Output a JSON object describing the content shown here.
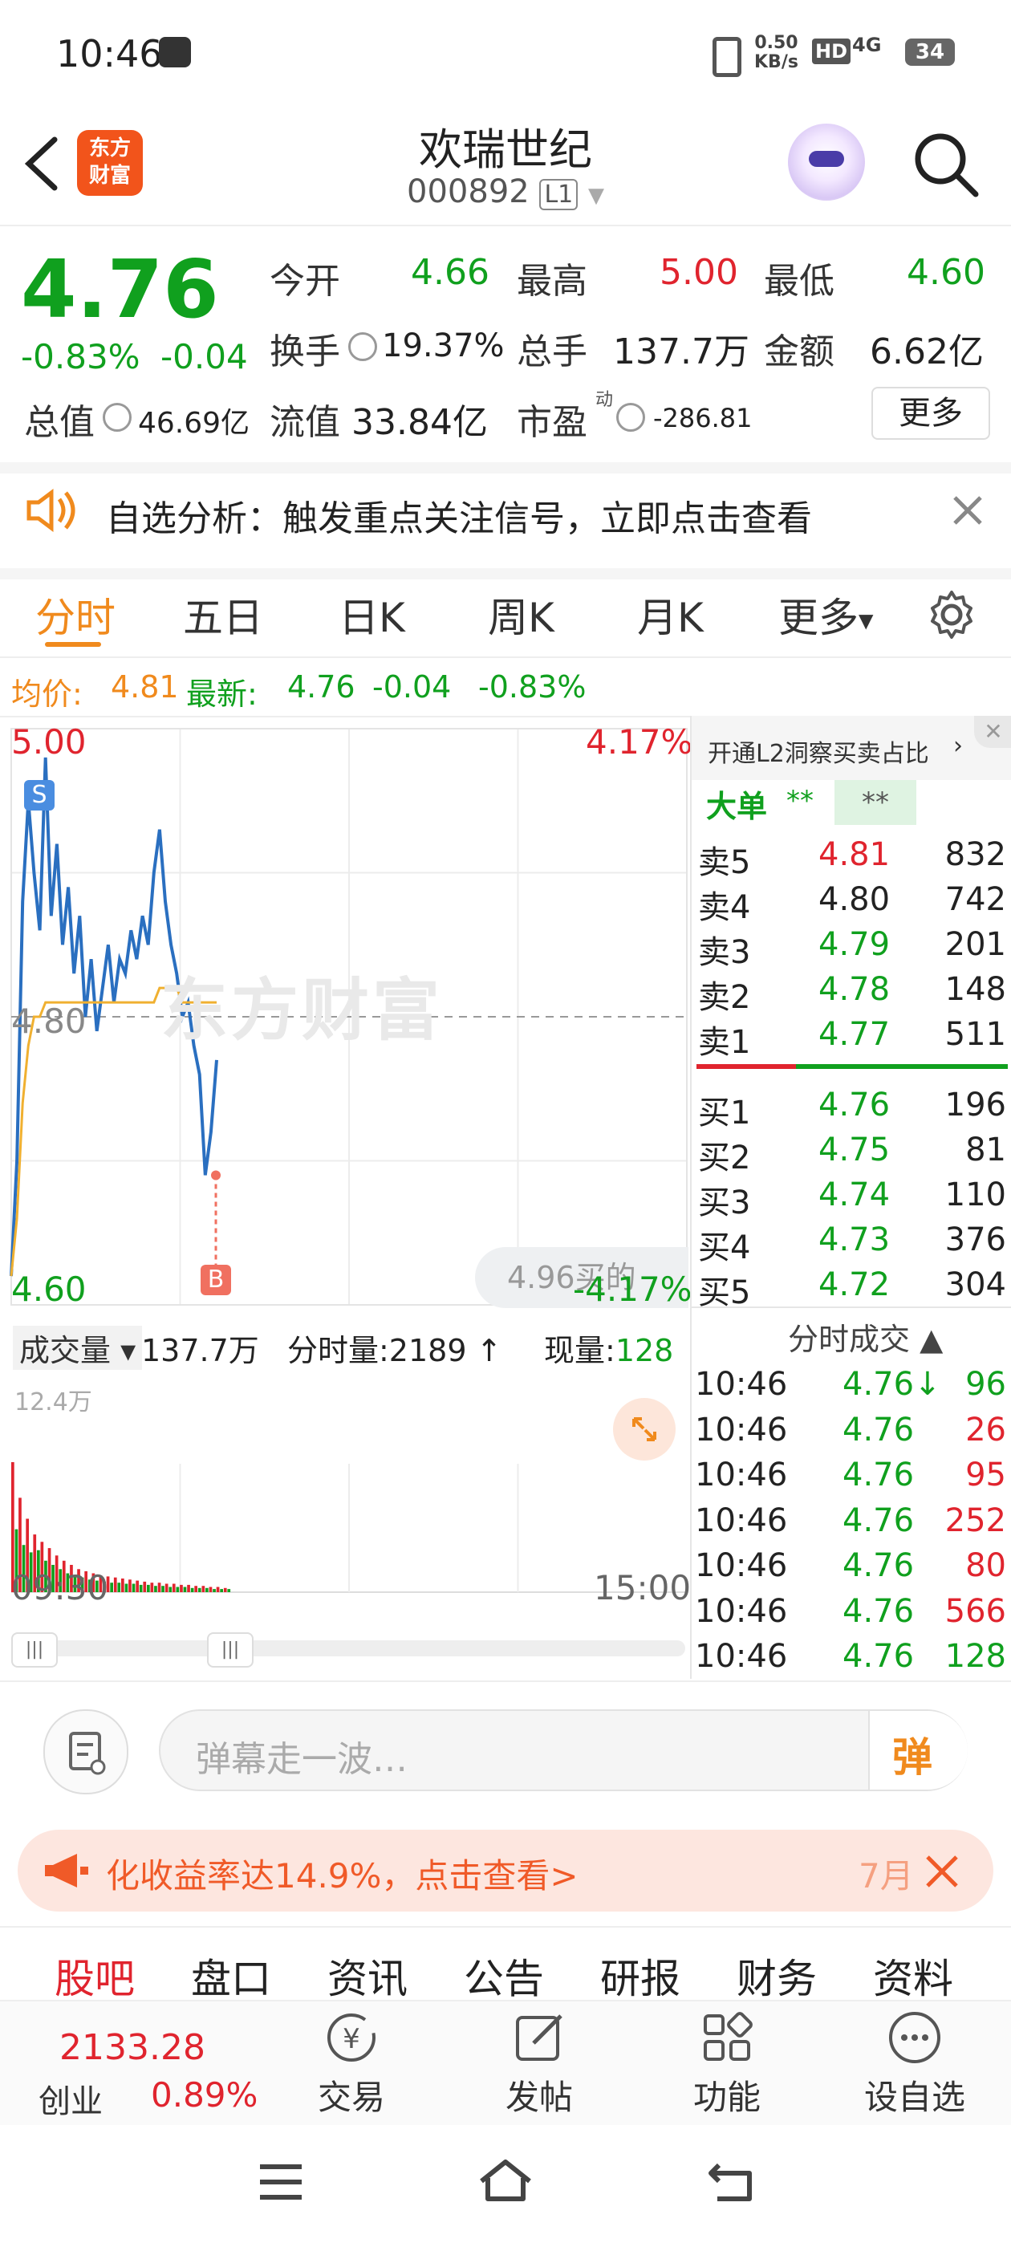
{
  "status_bar": {
    "time": "10:46",
    "net_speed_top": "0.50",
    "net_speed_bottom": "KB/s",
    "hd": "HD",
    "signal": "4G",
    "battery": "34"
  },
  "header": {
    "logo_line1": "东方",
    "logo_line2": "财富",
    "title": "欢瑞世纪",
    "code": "000892",
    "level": "L1"
  },
  "quote": {
    "price": "4.76",
    "change_pct": "-0.83%",
    "change": "-0.04",
    "open_label": "今开",
    "open": "4.66",
    "high_label": "最高",
    "high": "5.00",
    "low_label": "最低",
    "low": "4.60",
    "turnover_label": "换手",
    "turnover": "19.37%",
    "volume_label": "总手",
    "volume": "137.7万",
    "amount_label": "金额",
    "amount": "6.62亿",
    "total_value_label": "总值",
    "total_value": "46.69亿",
    "float_value_label": "流值",
    "float_value": "33.84亿",
    "pe_label": "市盈",
    "pe_sup": "动",
    "pe": "-286.81",
    "more_button": "更多"
  },
  "alert": {
    "text": "自选分析：触发重点关注信号，立即点击查看"
  },
  "tabs": [
    {
      "label": "分时",
      "active": true
    },
    {
      "label": "五日"
    },
    {
      "label": "日K"
    },
    {
      "label": "周K"
    },
    {
      "label": "月K"
    },
    {
      "label": "更多"
    }
  ],
  "price_line": {
    "avg_label": "均价:",
    "avg": "4.81",
    "latest_label": "最新:",
    "latest": "4.76",
    "change": "-0.04",
    "change_pct": "-0.83%"
  },
  "chart": {
    "y_top": "5.00",
    "y_mid": "4.80",
    "y_bottom": "4.60",
    "pct_top": "4.17%",
    "pct_bottom": "-4.17%",
    "marker_s": "S",
    "marker_b": "B",
    "watermark": "东方财富",
    "bubble": "4.96买的",
    "vol_label": "成交量",
    "vol_total": "137.7万",
    "vol_tick_label": "分时量:2189",
    "cur_vol_label": "现量:",
    "cur_vol": "128",
    "vol_max": "12.4万",
    "time_start": "09:30",
    "time_end": "15:00"
  },
  "chart_data": {
    "type": "line",
    "title": "",
    "x_range": [
      "09:30",
      "15:00"
    ],
    "ylim": [
      4.6,
      5.0
    ],
    "pct_range": [
      "-4.17%",
      "4.17%"
    ],
    "reference_price": 4.8,
    "series": [
      {
        "name": "",
        "color": "#2a6fc0",
        "values": [
          4.62,
          4.7,
          4.88,
          4.95,
          4.9,
          4.86,
          4.98,
          4.87,
          4.92,
          4.85,
          4.89,
          4.83,
          4.87,
          4.8,
          4.84,
          4.79,
          4.82,
          4.85,
          4.81,
          4.84,
          4.83,
          4.86,
          4.84,
          4.87,
          4.85,
          4.9,
          4.93,
          4.88,
          4.85,
          4.83,
          4.8,
          4.81,
          4.78,
          4.76,
          4.69,
          4.72,
          4.77
        ]
      },
      {
        "name": "",
        "color": "#f0b030",
        "values": [
          4.62,
          4.66,
          4.74,
          4.78,
          4.8,
          4.8,
          4.81,
          4.81,
          4.81,
          4.81,
          4.81,
          4.81,
          4.81,
          4.81,
          4.81,
          4.81,
          4.81,
          4.81,
          4.81,
          4.81,
          4.81,
          4.81,
          4.81,
          4.81,
          4.81,
          4.81,
          4.82,
          4.82,
          4.82,
          4.82,
          4.81,
          4.81,
          4.81,
          4.81,
          4.81,
          4.81,
          4.81
        ]
      }
    ],
    "volume": {
      "ylim": [
        0,
        124000
      ],
      "values": [
        124000,
        60000,
        90000,
        45000,
        70000,
        38000,
        55000,
        40000,
        48000,
        30000,
        42000,
        26000,
        35000,
        22000,
        30000,
        18000,
        26000,
        16000,
        22000,
        14000,
        20000,
        12000,
        18000,
        11000,
        16000,
        10000,
        15000,
        9000,
        14000,
        9000,
        13000,
        8000,
        12000,
        8000,
        11000,
        7000,
        10000,
        7000,
        9000,
        6000,
        9000,
        6000,
        8000,
        5000,
        8000,
        5000,
        7000,
        5000,
        7000,
        4000,
        6000,
        4000,
        6000,
        4000,
        5000,
        3000,
        5000,
        3000,
        4000,
        3000
      ],
      "colors": [
        "red",
        "green"
      ]
    }
  },
  "order_book": {
    "l2_banner": "开通L2洞察买卖占比",
    "big_label": "大单",
    "big_value1": "**",
    "big_value2": "**",
    "sells": [
      {
        "label": "卖5",
        "price": "4.81",
        "vol": "832",
        "color": "red"
      },
      {
        "label": "卖4",
        "price": "4.80",
        "vol": "742",
        "color": "black"
      },
      {
        "label": "卖3",
        "price": "4.79",
        "vol": "201",
        "color": "green"
      },
      {
        "label": "卖2",
        "price": "4.78",
        "vol": "148",
        "color": "green"
      },
      {
        "label": "卖1",
        "price": "4.77",
        "vol": "511",
        "color": "green"
      }
    ],
    "buys": [
      {
        "label": "买1",
        "price": "4.76",
        "vol": "196",
        "color": "green"
      },
      {
        "label": "买2",
        "price": "4.75",
        "vol": "81",
        "color": "green"
      },
      {
        "label": "买3",
        "price": "4.74",
        "vol": "110",
        "color": "green"
      },
      {
        "label": "买4",
        "price": "4.73",
        "vol": "376",
        "color": "green"
      },
      {
        "label": "买5",
        "price": "4.72",
        "vol": "304",
        "color": "green"
      }
    ],
    "trades_title": "分时成交",
    "trades": [
      {
        "time": "10:46",
        "price": "4.76",
        "arrow": "↓",
        "vol": "96",
        "vcolor": "green"
      },
      {
        "time": "10:46",
        "price": "4.76",
        "arrow": "",
        "vol": "26",
        "vcolor": "red"
      },
      {
        "time": "10:46",
        "price": "4.76",
        "arrow": "",
        "vol": "95",
        "vcolor": "red"
      },
      {
        "time": "10:46",
        "price": "4.76",
        "arrow": "",
        "vol": "252",
        "vcolor": "red"
      },
      {
        "time": "10:46",
        "price": "4.76",
        "arrow": "",
        "vol": "80",
        "vcolor": "red"
      },
      {
        "time": "10:46",
        "price": "4.76",
        "arrow": "",
        "vol": "566",
        "vcolor": "red"
      },
      {
        "time": "10:46",
        "price": "4.76",
        "arrow": "",
        "vol": "128",
        "vcolor": "green"
      }
    ]
  },
  "comment": {
    "placeholder": "弹幕走一波…",
    "danmu_button": "弹"
  },
  "promo": {
    "text": "化收益率达14.9%，点击查看>",
    "suffix": "7月"
  },
  "sub_tabs": [
    "股吧",
    "盘口",
    "资讯",
    "公告",
    "研报",
    "财务",
    "资料"
  ],
  "bottom_nav": {
    "index_value": "2133.28",
    "index_name": "创业",
    "index_change": "0.89%",
    "items": [
      "交易",
      "发帖",
      "功能",
      "设自选"
    ]
  },
  "colors": {
    "up": "#e0242e",
    "down": "#10a01e",
    "accent": "#f08a1d",
    "line": "#2a6fc0",
    "avg": "#f0b030"
  }
}
